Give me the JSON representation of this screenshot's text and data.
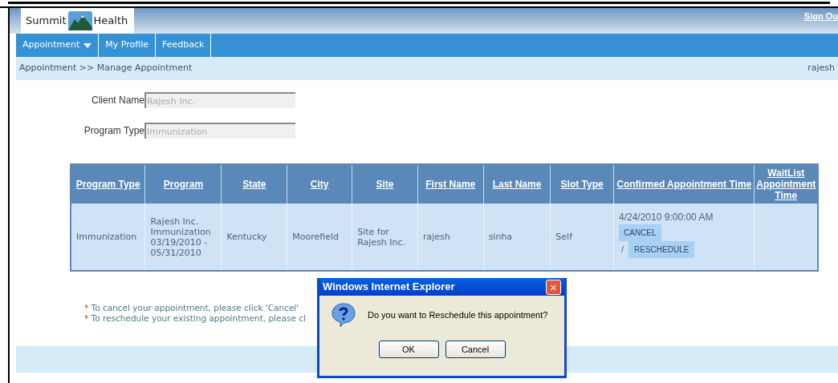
{
  "header": {
    "logo_left": "Summit",
    "logo_right": "Health",
    "sign_out": "Sign Ou"
  },
  "nav": [
    {
      "label": "Appointment",
      "dropdown": true
    },
    {
      "label": "My Profile",
      "dropdown": false
    },
    {
      "label": "Feedback",
      "dropdown": false
    }
  ],
  "breadcrumb": {
    "path": "Appointment >> Manage Appointment",
    "user": "rajesh"
  },
  "fields": [
    {
      "label": "Client Name",
      "value": "Rajesh Inc.",
      "disabled": true
    },
    {
      "label": "Program Type",
      "value": "Immunization",
      "disabled": true
    }
  ],
  "table": {
    "columns": [
      "Program Type",
      "Program",
      "State",
      "City",
      "Site",
      "First Name",
      "Last Name",
      "Slot Type",
      "Confirmed Appointment Time",
      "WaitList Appointment Time"
    ],
    "rows": [
      {
        "cells": [
          "Immunization",
          "Rajesh Inc. Immunization 03/19/2010 - 05/31/2010",
          "Kentucky",
          "Moorefield",
          "Site for Rajesh Inc.",
          "rajesh",
          "sinha",
          "Self"
        ],
        "confirmed_time": "4/24/2010 9:00:00 AM",
        "cancel": "CANCEL",
        "separator": "/",
        "reschedule": "RESCHEDULE"
      }
    ]
  },
  "notes": [
    {
      "marker": "*",
      "text": "To cancel your appointment, please click 'Cancel'"
    },
    {
      "marker": "*",
      "text": "To reschedule your existing appointment, please cl"
    }
  ],
  "dialog": {
    "title": "Windows Internet Explorer",
    "close": "×",
    "message": "Do you want to Reschedule this appointment?",
    "buttons": [
      "OK",
      "Cancel"
    ]
  }
}
